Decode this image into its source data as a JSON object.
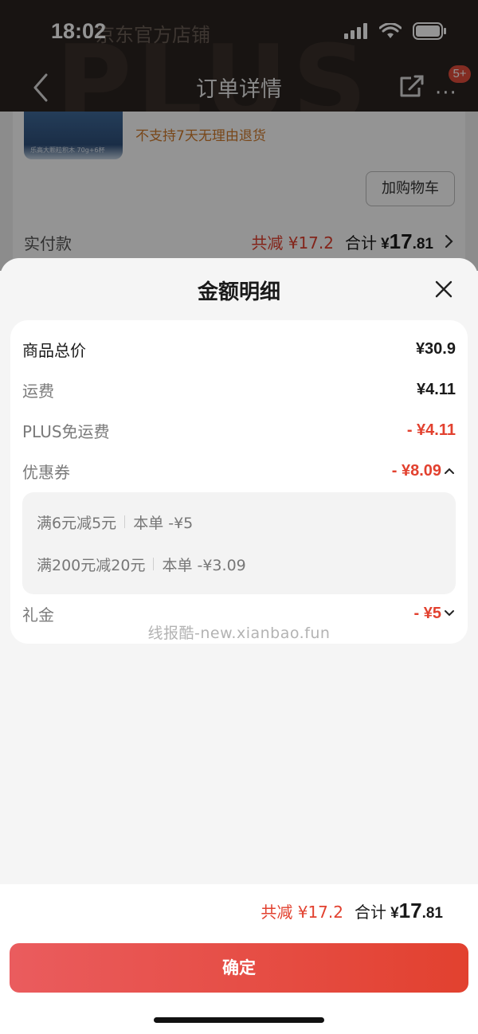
{
  "status_bar": {
    "time": "18:02"
  },
  "background_page": {
    "marquee": "京东官方店铺",
    "watermark_text": "PLUS",
    "nav_title": "订单详情",
    "nav_more": "···",
    "nav_badge": "5+",
    "thumb_caption": "乐高大颗粒积木 70g+6杯",
    "no_return_text": "不支持7天无理由退货",
    "add_cart_label": "加购物车",
    "paid_label": "实付款",
    "paid_save": "共减 ¥17.2",
    "paid_sum_label": "合计",
    "paid_currency": "¥",
    "paid_integer": "17",
    "paid_decimal": ".81"
  },
  "sheet": {
    "title": "金额明细",
    "rows": [
      {
        "label": "商品总价",
        "value": "¥30.9"
      },
      {
        "label": "运费",
        "value": "¥4.11"
      },
      {
        "label": "PLUS免运费",
        "value": "- ¥4.11"
      },
      {
        "label": "优惠券",
        "value": "- ¥8.09"
      },
      {
        "label": "礼金",
        "value": "- ¥5"
      }
    ],
    "coupons": [
      {
        "rule": "满6元减5元",
        "applied": "本单 -¥5"
      },
      {
        "rule": "满200元减20元",
        "applied": "本单 -¥3.09"
      }
    ],
    "watermark": "线报酷-new.xianbao.fun"
  },
  "footer": {
    "save_text": "共减 ¥17.2",
    "sum_label": "合计",
    "currency": "¥",
    "integer": "17",
    "decimal": ".81",
    "confirm_label": "确定"
  },
  "colors": {
    "accent_red": "#e2412f",
    "button_gradient_start": "#ea5c5e",
    "button_gradient_end": "#e2412f"
  }
}
